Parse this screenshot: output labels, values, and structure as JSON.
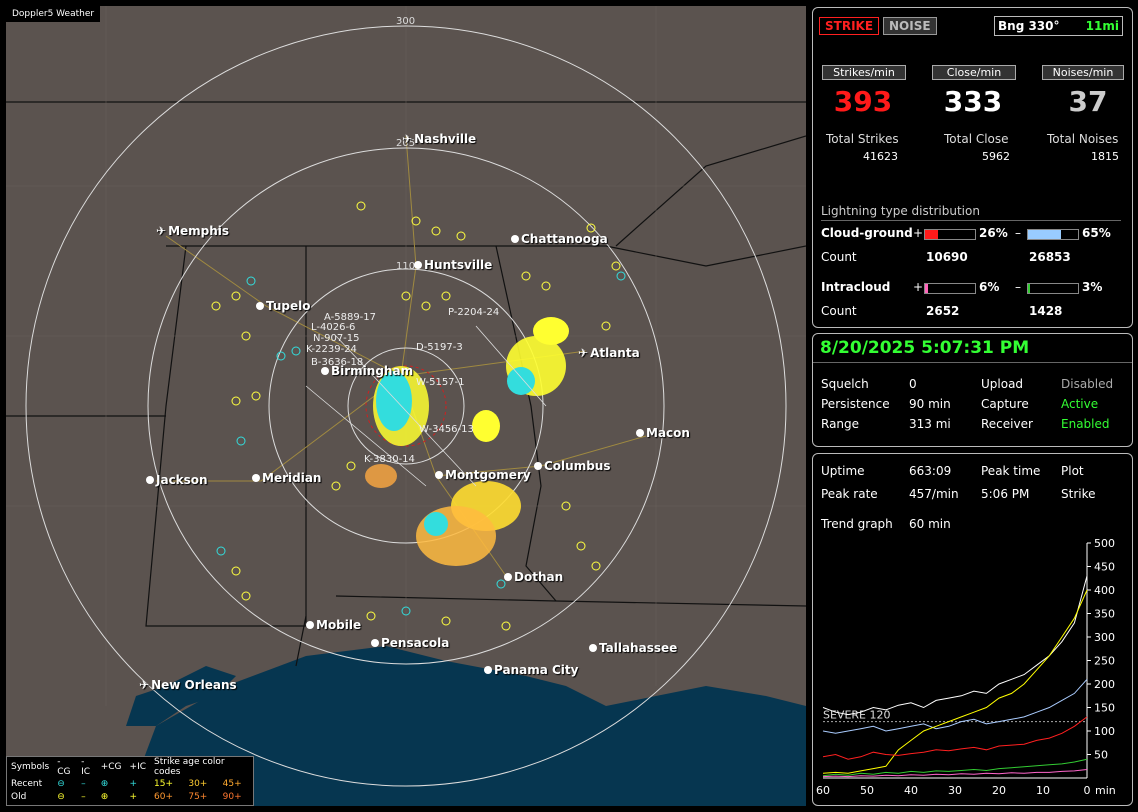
{
  "map": {
    "title": "Doppler5 Weather",
    "rings": [
      "300",
      "205",
      "110"
    ],
    "cities": [
      {
        "name": "Nashville",
        "airport": true
      },
      {
        "name": "Memphis",
        "airport": true
      },
      {
        "name": "Chattanooga",
        "airport": false
      },
      {
        "name": "Huntsville",
        "airport": false
      },
      {
        "name": "Tupelo",
        "airport": false
      },
      {
        "name": "Birmingham",
        "airport": false
      },
      {
        "name": "Atlanta",
        "airport": true
      },
      {
        "name": "Macon",
        "airport": false
      },
      {
        "name": "Jackson",
        "airport": false
      },
      {
        "name": "Meridian",
        "airport": false
      },
      {
        "name": "Montgomery",
        "airport": false
      },
      {
        "name": "Columbus",
        "airport": false
      },
      {
        "name": "Dothan",
        "airport": false
      },
      {
        "name": "Mobile",
        "airport": false
      },
      {
        "name": "Pensacola",
        "airport": false
      },
      {
        "name": "Tallahassee",
        "airport": false
      },
      {
        "name": "Panama City",
        "airport": false
      },
      {
        "name": "New Orleans",
        "airport": true
      }
    ],
    "storm_labels": [
      "A-5889-17",
      "L-4026-6",
      "N-907-15",
      "K-2239-24",
      "B-3636-18",
      "P-2204-24",
      "D-5197-3",
      "W-5157-1",
      "W-3456-13",
      "K-3830-14"
    ],
    "legend": {
      "header": [
        "Symbols",
        "-CG",
        "-IC",
        "+CG",
        "+IC",
        "Strike age color codes"
      ],
      "recent": {
        "label": "Recent",
        "ages": [
          "15+",
          "30+",
          "45+"
        ]
      },
      "old": {
        "label": "Old",
        "ages": [
          "60+",
          "75+",
          "90+"
        ]
      }
    }
  },
  "top": {
    "strike_btn": "STRIKE",
    "noise_btn": "NOISE",
    "bearing": "Bng 330°",
    "distance": "11mi",
    "strikes_label": "Strikes/min",
    "strikes_val": "393",
    "close_label": "Close/min",
    "close_val": "333",
    "noises_label": "Noises/min",
    "noises_val": "37",
    "total_strikes_label": "Total Strikes",
    "total_strikes": "41623",
    "total_close_label": "Total Close",
    "total_close": "5962",
    "total_noises_label": "Total Noises",
    "total_noises": "1815",
    "dist_title": "Lightning type distribution",
    "cg_label": "Cloud-ground",
    "cg_pos_pct": "26%",
    "cg_neg_pct": "65%",
    "cg_pos_frac": 0.26,
    "cg_neg_frac": 0.65,
    "count_label": "Count",
    "cg_pos_count": "10690",
    "cg_neg_count": "26853",
    "ic_label": "Intracloud",
    "ic_pos_pct": "6%",
    "ic_neg_pct": "3%",
    "ic_pos_frac": 0.06,
    "ic_neg_frac": 0.03,
    "ic_pos_count": "2652",
    "ic_neg_count": "1428",
    "plus": "+",
    "minus": "–"
  },
  "status": {
    "datetime": "8/20/2025 5:07:31 PM",
    "squelch_label": "Squelch",
    "squelch": "0",
    "upload_label": "Upload",
    "upload": "Disabled",
    "persistence_label": "Persistence",
    "persistence": "90 min",
    "capture_label": "Capture",
    "capture": "Active",
    "range_label": "Range",
    "range": "313 mi",
    "receiver_label": "Receiver",
    "receiver": "Enabled"
  },
  "trend": {
    "uptime_label": "Uptime",
    "uptime": "663:09",
    "peaktime_label": "Peak time",
    "plot_label": "Plot",
    "peakrate_label": "Peak rate",
    "peakrate": "457/min",
    "peaktime": "5:06 PM",
    "plot": "Strike",
    "trend_label": "Trend graph",
    "trend_val": "60 min",
    "severe": "SEVERE 120"
  },
  "chart_data": {
    "type": "line",
    "x_label": "min",
    "x_ticks": [
      "60",
      "50",
      "40",
      "30",
      "20",
      "10",
      "0"
    ],
    "y_ticks": [
      "500",
      "450",
      "400",
      "350",
      "300",
      "250",
      "200",
      "150",
      "100",
      "50"
    ],
    "ylim": [
      0,
      500
    ],
    "threshold": 120,
    "series": [
      {
        "color": "#ffffff",
        "values": [
          150,
          140,
          135,
          140,
          150,
          145,
          155,
          160,
          150,
          165,
          170,
          175,
          185,
          180,
          200,
          210,
          220,
          240,
          260,
          290,
          330,
          430
        ]
      },
      {
        "color": "#aaccff",
        "values": [
          100,
          95,
          100,
          105,
          110,
          100,
          105,
          110,
          115,
          105,
          110,
          120,
          125,
          115,
          120,
          125,
          130,
          140,
          150,
          165,
          180,
          210
        ]
      },
      {
        "color": "#ffff00",
        "values": [
          10,
          12,
          10,
          15,
          20,
          25,
          60,
          80,
          100,
          110,
          120,
          130,
          140,
          150,
          170,
          180,
          200,
          230,
          260,
          300,
          340,
          400
        ]
      },
      {
        "color": "#ff2020",
        "values": [
          45,
          50,
          40,
          45,
          55,
          50,
          48,
          52,
          55,
          60,
          58,
          62,
          65,
          60,
          68,
          70,
          72,
          80,
          85,
          95,
          110,
          130
        ]
      },
      {
        "color": "#33cc33",
        "values": [
          5,
          8,
          6,
          10,
          8,
          12,
          10,
          14,
          12,
          15,
          14,
          16,
          18,
          16,
          20,
          22,
          24,
          26,
          28,
          30,
          34,
          40
        ]
      },
      {
        "color": "#ff66cc",
        "values": [
          3,
          4,
          3,
          5,
          4,
          6,
          5,
          7,
          6,
          8,
          7,
          9,
          8,
          10,
          9,
          11,
          10,
          12,
          12,
          14,
          15,
          18
        ]
      }
    ]
  }
}
